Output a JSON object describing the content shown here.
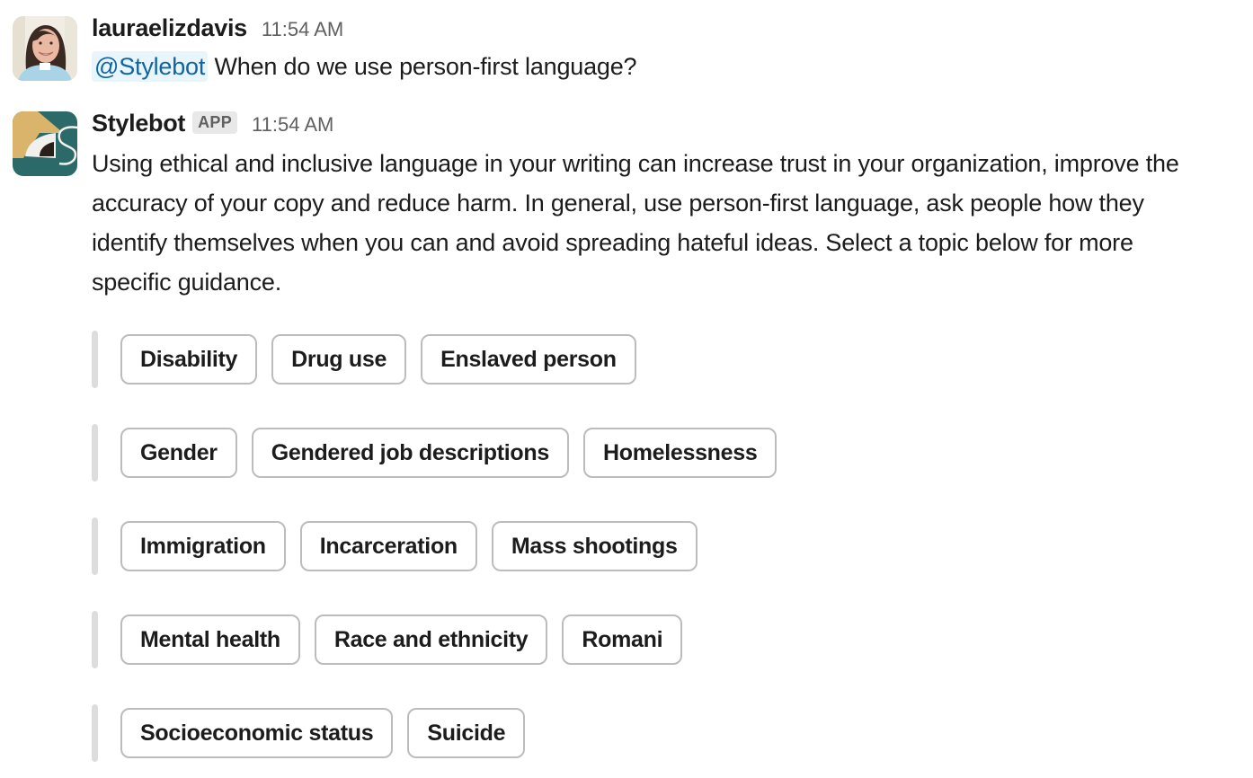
{
  "messages": [
    {
      "sender": "lauraelizdavis",
      "timestamp": "11:54 AM",
      "avatar": "user-photo-avatar",
      "mention": "@Stylebot",
      "text": " When do we use person-first language?"
    },
    {
      "sender": "Stylebot",
      "badge": "APP",
      "timestamp": "11:54 AM",
      "avatar": "stylebot-logo-avatar",
      "text": "Using ethical and inclusive language in your writing can increase trust in your organization, improve the accuracy of your copy and reduce harm. In general, use person-first language, ask people how they identify themselves when you can and avoid spreading hateful ideas. Select a topic below for more specific guidance."
    }
  ],
  "topic_blocks": [
    [
      "Disability",
      "Drug use",
      "Enslaved person"
    ],
    [
      "Gender",
      "Gendered job descriptions",
      "Homelessness"
    ],
    [
      "Immigration",
      "Incarceration",
      "Mass shootings"
    ],
    [
      "Mental health",
      "Race and ethnicity",
      "Romani"
    ],
    [
      "Socioeconomic status",
      "Suicide"
    ]
  ],
  "colors": {
    "mention_bg": "#e8f5fa",
    "mention_text": "#1264a3",
    "logo_teal": "#2b6a68",
    "logo_gold": "#d9b46a",
    "chip_border": "#bcbcbc",
    "block_bar": "#dddddd"
  }
}
